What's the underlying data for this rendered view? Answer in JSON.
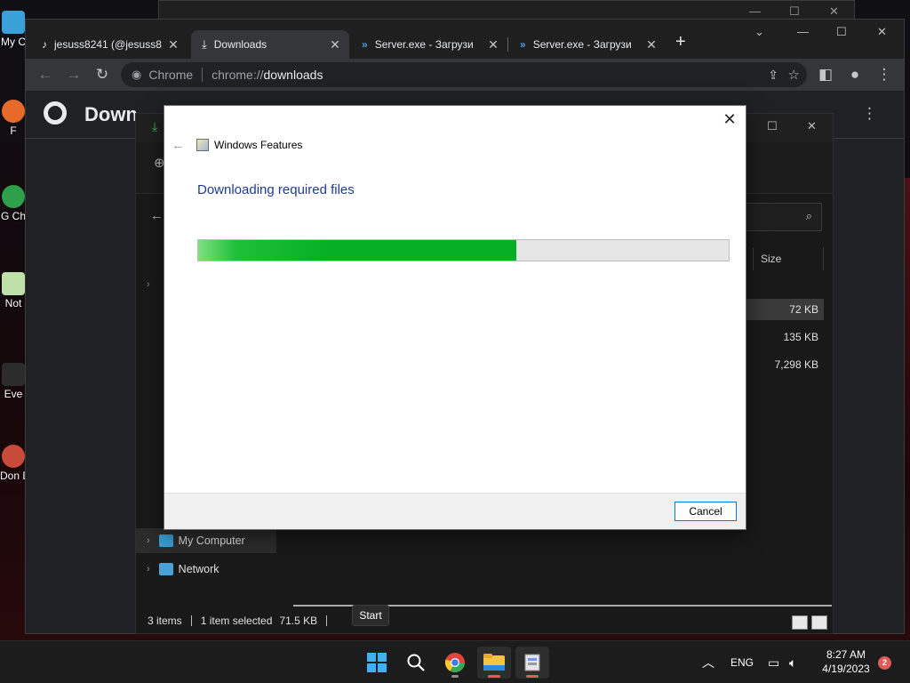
{
  "desktop": {
    "icons": [
      {
        "label": "My C"
      },
      {
        "label": "F"
      },
      {
        "label": "G Ch"
      },
      {
        "label": "Not"
      },
      {
        "label": "Eve"
      },
      {
        "label": "Don D"
      }
    ]
  },
  "browser": {
    "tabs": [
      {
        "title": "jesuss8241 (@jesuss8"
      },
      {
        "title": "Downloads"
      },
      {
        "title": "Server.exe - Загрузи"
      },
      {
        "title": "Server.exe - Загрузи"
      }
    ],
    "new_tab_label": "+",
    "omnibox": {
      "site_label": "Chrome",
      "url_prefix": "chrome://",
      "url_main": "downloads"
    },
    "page_title": "Down"
  },
  "explorer": {
    "size_header": "Size",
    "sizes": [
      "72 KB",
      "135 KB",
      "7,298 KB"
    ],
    "nav": [
      {
        "label": "My Computer"
      },
      {
        "label": "Network"
      }
    ],
    "status": {
      "items": "3 items",
      "selected": "1 item selected",
      "size": "71.5 KB"
    }
  },
  "dialog": {
    "app_title": "Windows Features",
    "heading": "Downloading required files",
    "progress_percent": 60,
    "cancel_label": "Cancel",
    "close_label": "✕"
  },
  "taskbar": {
    "start_tooltip": "Start",
    "language": "ENG",
    "time": "8:27 AM",
    "date": "4/19/2023",
    "notifications": "2"
  },
  "colors": {
    "progress": "#06b025",
    "dialog_heading": "#1f3a93",
    "chrome_frame": "#202124"
  }
}
